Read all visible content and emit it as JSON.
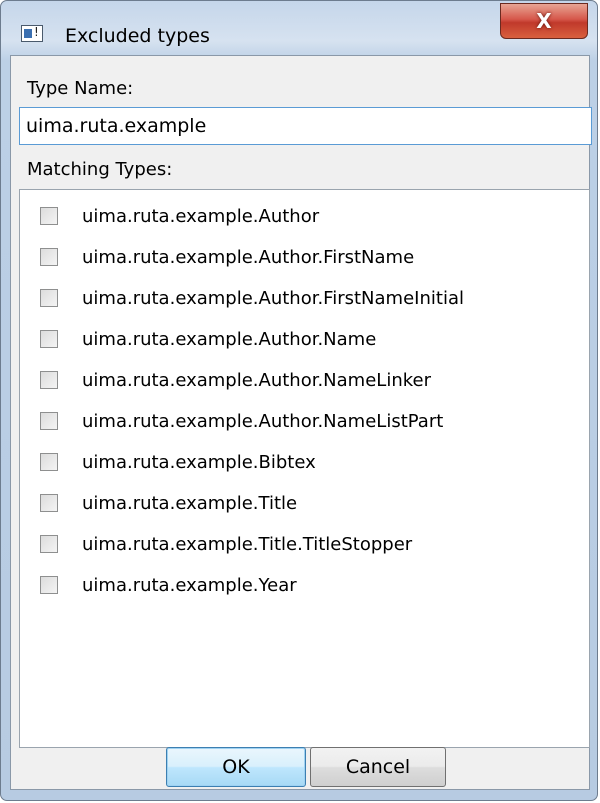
{
  "window": {
    "title": "Excluded types",
    "icon": "app-window-icon",
    "close_label": "X"
  },
  "type_name": {
    "label": "Type Name:",
    "value": "uima.ruta.example"
  },
  "matching": {
    "label": "Matching Types:",
    "items": [
      {
        "label": "uima.ruta.example.Author",
        "checked": false
      },
      {
        "label": "uima.ruta.example.Author.FirstName",
        "checked": false
      },
      {
        "label": "uima.ruta.example.Author.FirstNameInitial",
        "checked": false
      },
      {
        "label": "uima.ruta.example.Author.Name",
        "checked": false
      },
      {
        "label": "uima.ruta.example.Author.NameLinker",
        "checked": false
      },
      {
        "label": "uima.ruta.example.Author.NameListPart",
        "checked": false
      },
      {
        "label": "uima.ruta.example.Bibtex",
        "checked": false
      },
      {
        "label": "uima.ruta.example.Title",
        "checked": false
      },
      {
        "label": "uima.ruta.example.Title.TitleStopper",
        "checked": false
      },
      {
        "label": "uima.ruta.example.Year",
        "checked": false
      }
    ]
  },
  "buttons": {
    "ok": "OK",
    "cancel": "Cancel"
  },
  "colors": {
    "close_button": "#c0392b",
    "focus_border": "#5a9bd5",
    "default_button": "#bee6fd"
  }
}
